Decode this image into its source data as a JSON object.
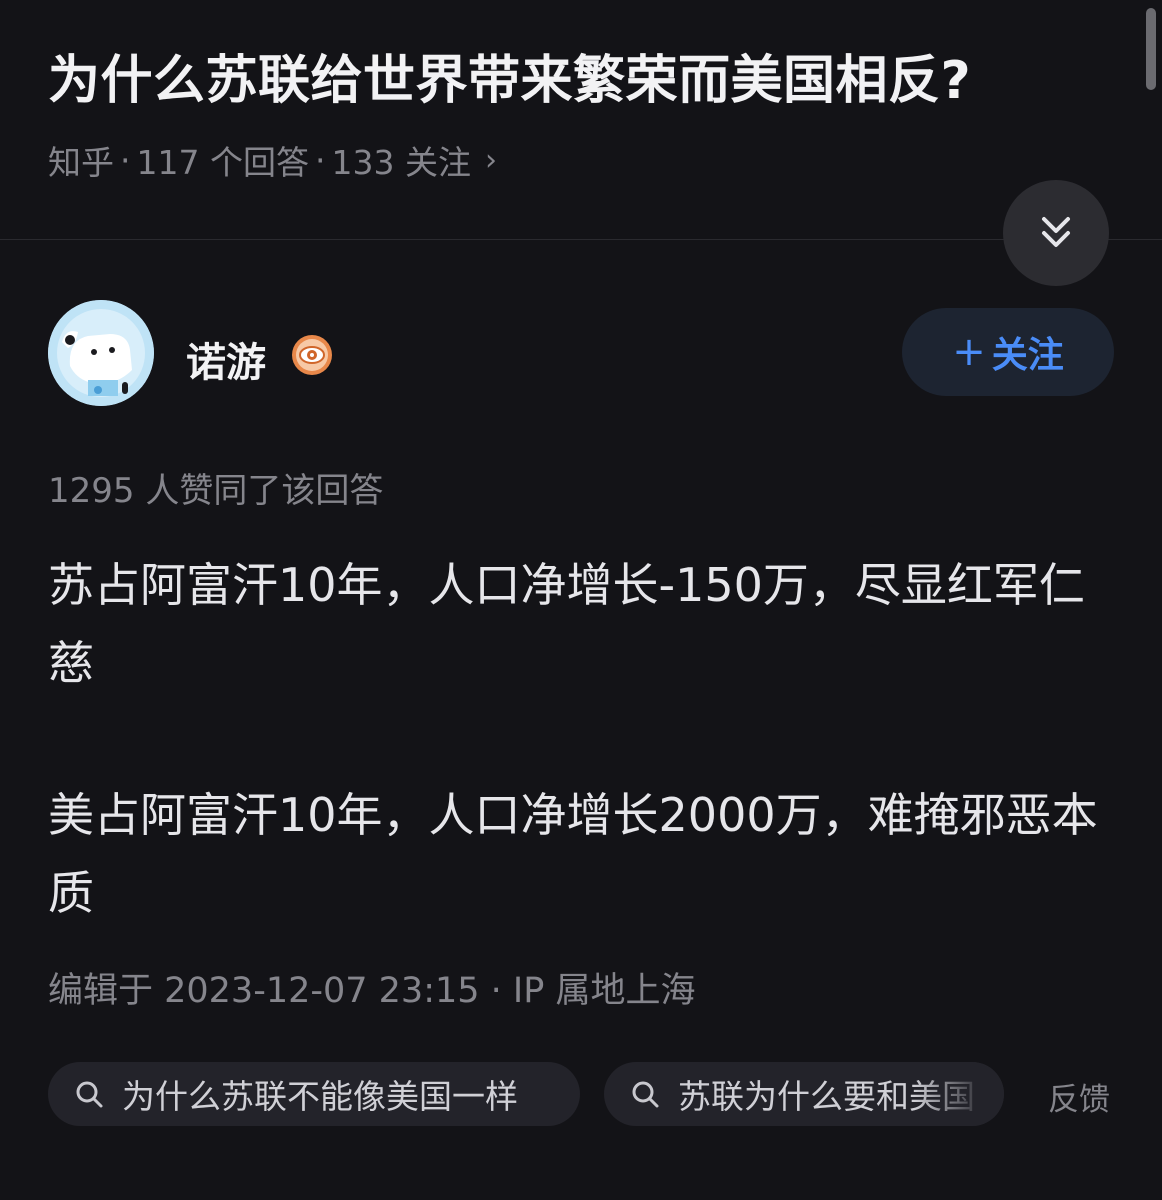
{
  "question": {
    "title": "为什么苏联给世界带来繁荣而美国相反?",
    "source": "知乎",
    "answers": "117 个回答",
    "followers": "133 关注",
    "chevron": "›"
  },
  "author": {
    "name": "诺游",
    "badge_icon": "eye-badge-icon",
    "follow_label": "关注",
    "follow_plus": "+"
  },
  "answer": {
    "votes": "1295 人赞同了该回答",
    "paragraphs": [
      "苏占阿富汗10年，人口净增长-150万，尽显红军仁慈",
      "美占阿富汗10年，人口净增长2000万，难掩邪恶本质"
    ],
    "edited": "编辑于 2023-12-07 23:15 · IP 属地上海"
  },
  "related_searches": [
    "为什么苏联不能像美国一样",
    "苏联为什么要和美国"
  ],
  "feedback_label": "反馈",
  "colors": {
    "background": "#131317",
    "accent": "#4a8cf7",
    "muted_text": "#85858c",
    "chip_bg": "#23232a"
  }
}
